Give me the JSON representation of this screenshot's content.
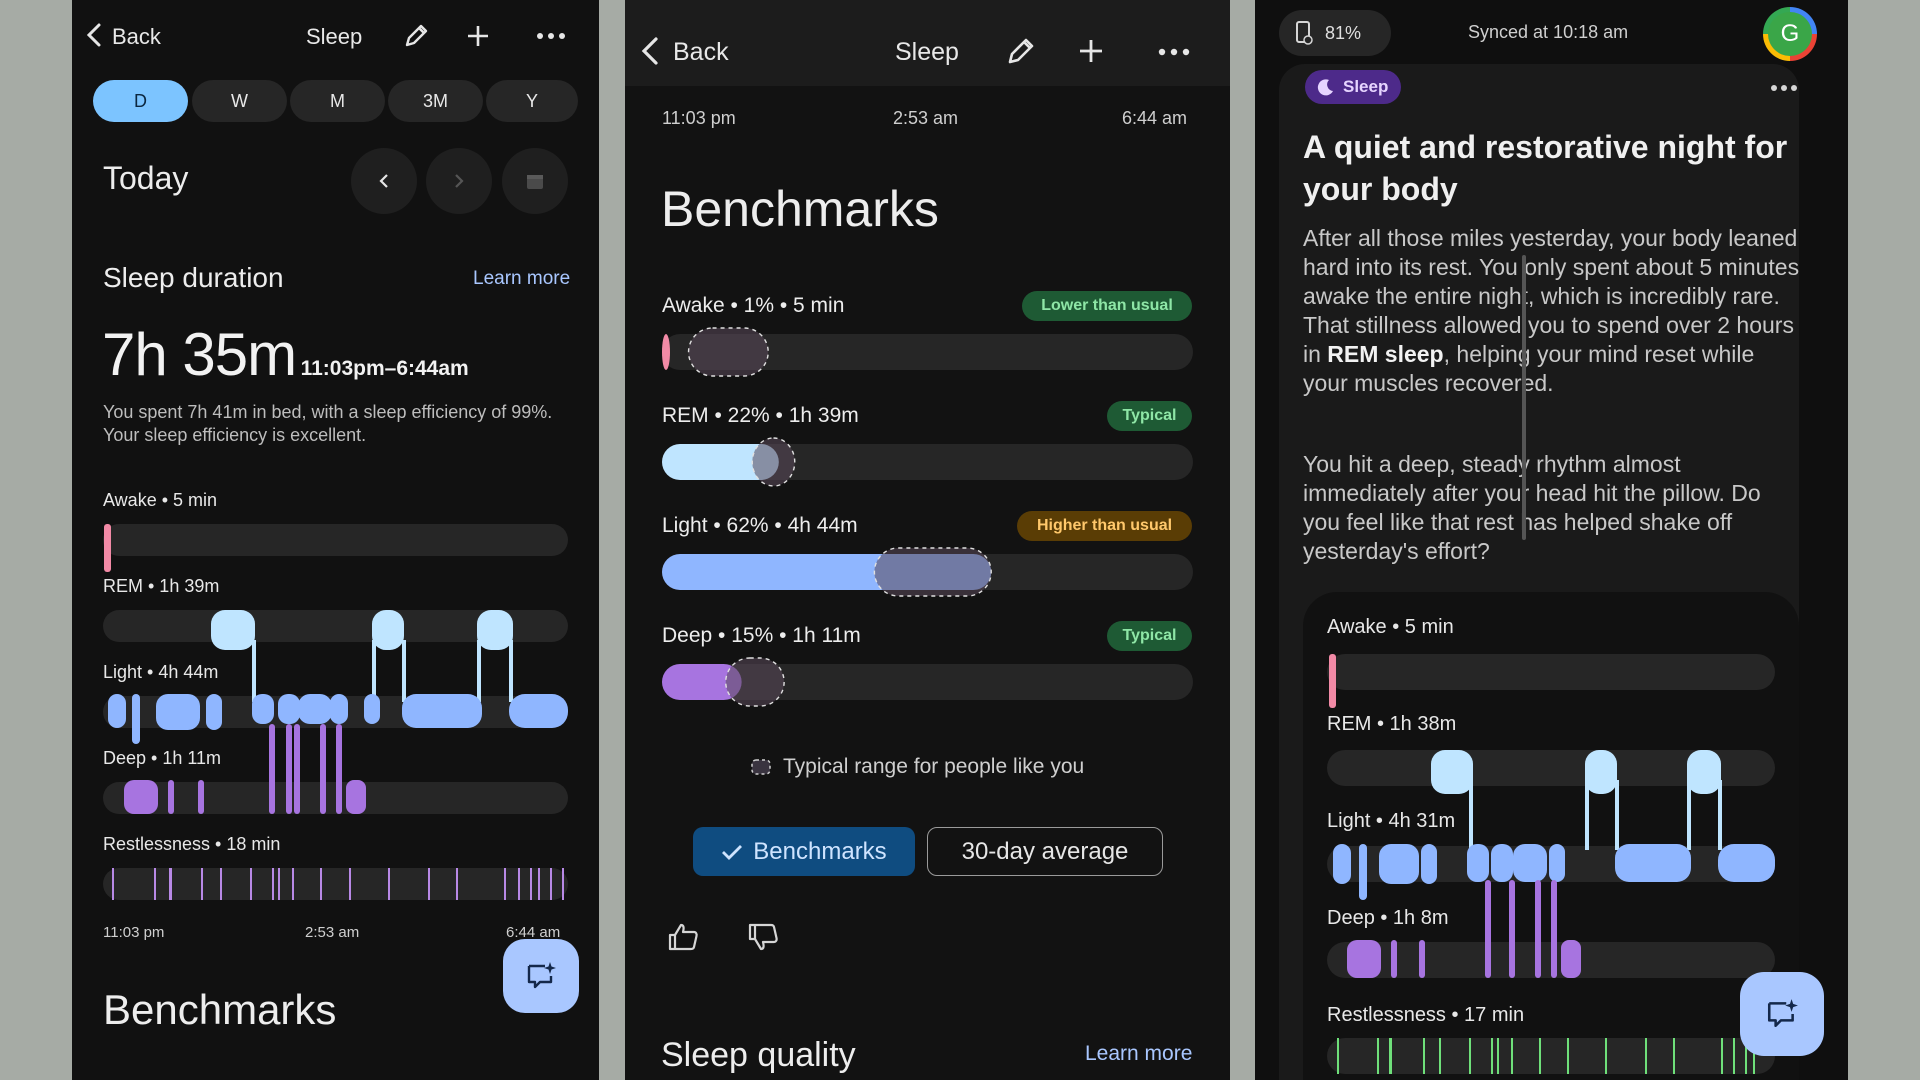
{
  "colors": {
    "awake": "#f28aa6",
    "rem": "#bfe5ff",
    "light": "#8fb6ff",
    "deep": "#a774e0",
    "restless": "#b889e6",
    "restless_green": "#6fe07a",
    "chip_green_bg": "#1e5a34",
    "chip_green_fg": "#8ee6a6",
    "chip_amber_bg": "#5a3d05",
    "chip_amber_fg": "#ffc86b",
    "accent": "#a9c7ff"
  },
  "panel1": {
    "header": {
      "back": "Back",
      "title": "Sleep"
    },
    "tabs": [
      "D",
      "W",
      "M",
      "3M",
      "Y"
    ],
    "day_label": "Today",
    "section_title": "Sleep duration",
    "learn_more": "Learn more",
    "duration": "7h 35m",
    "time_range": "11:03pm–6:44am",
    "summary": "You spent 7h 41m in bed, with a sleep efficiency of 99%. Your sleep efficiency is excellent.",
    "stages": {
      "awake": "Awake • 5 min",
      "rem": "REM • 1h 39m",
      "light": "Light • 4h 44m",
      "deep": "Deep • 1h 11m",
      "restless": "Restlessness • 18 min"
    },
    "axis": [
      "11:03 pm",
      "2:53 am",
      "6:44 am"
    ],
    "bottom_title": "Benchmarks"
  },
  "panel2": {
    "header": {
      "back": "Back",
      "title": "Sleep"
    },
    "axis": [
      "11:03 pm",
      "2:53 am",
      "6:44 am"
    ],
    "title": "Benchmarks",
    "rows": [
      {
        "label": "Awake • 1% • 5 min",
        "chip": "Lower than usual",
        "tone": "green",
        "fill": 0.01,
        "range": [
          0.05,
          0.2
        ]
      },
      {
        "label": "REM • 22% • 1h 39m",
        "chip": "Typical",
        "tone": "green",
        "fill": 0.22,
        "range": [
          0.17,
          0.25
        ]
      },
      {
        "label": "Light • 62% • 4h 44m",
        "chip": "Higher than usual",
        "tone": "amber",
        "fill": 0.62,
        "range": [
          0.4,
          0.62
        ]
      },
      {
        "label": "Deep • 15% • 1h 11m",
        "chip": "Typical",
        "tone": "green",
        "fill": 0.15,
        "range": [
          0.12,
          0.23
        ]
      }
    ],
    "legend": "Typical range for people like you",
    "toggle_active": "Benchmarks",
    "toggle_inactive": "30-day average",
    "bottom_title": "Sleep quality",
    "learn_more": "Learn more"
  },
  "panel3": {
    "status": {
      "battery": "81%",
      "synced": "Synced at 10:18 am",
      "avatar": "G"
    },
    "tag": "Sleep",
    "headline": "A quiet and restorative night for your body",
    "para1_a": "After all those miles yesterday, your body leaned hard into its rest. You only spent about 5 minutes awake the entire night, which is incredibly rare. That stillness allowed you to spend over 2 hours in ",
    "para1_b": "REM sleep",
    "para1_c": ", helping your mind reset while your muscles recovered.",
    "para2": "You hit a deep, steady rhythm almost immediately after your head hit the pillow. Do you feel like that rest has helped shake off yesterday's effort?",
    "stages": {
      "awake": "Awake • 5 min",
      "rem": "REM • 1h 38m",
      "light": "Light • 4h 31m",
      "deep": "Deep • 1h 8m",
      "restless": "Restlessness • 17 min"
    }
  }
}
